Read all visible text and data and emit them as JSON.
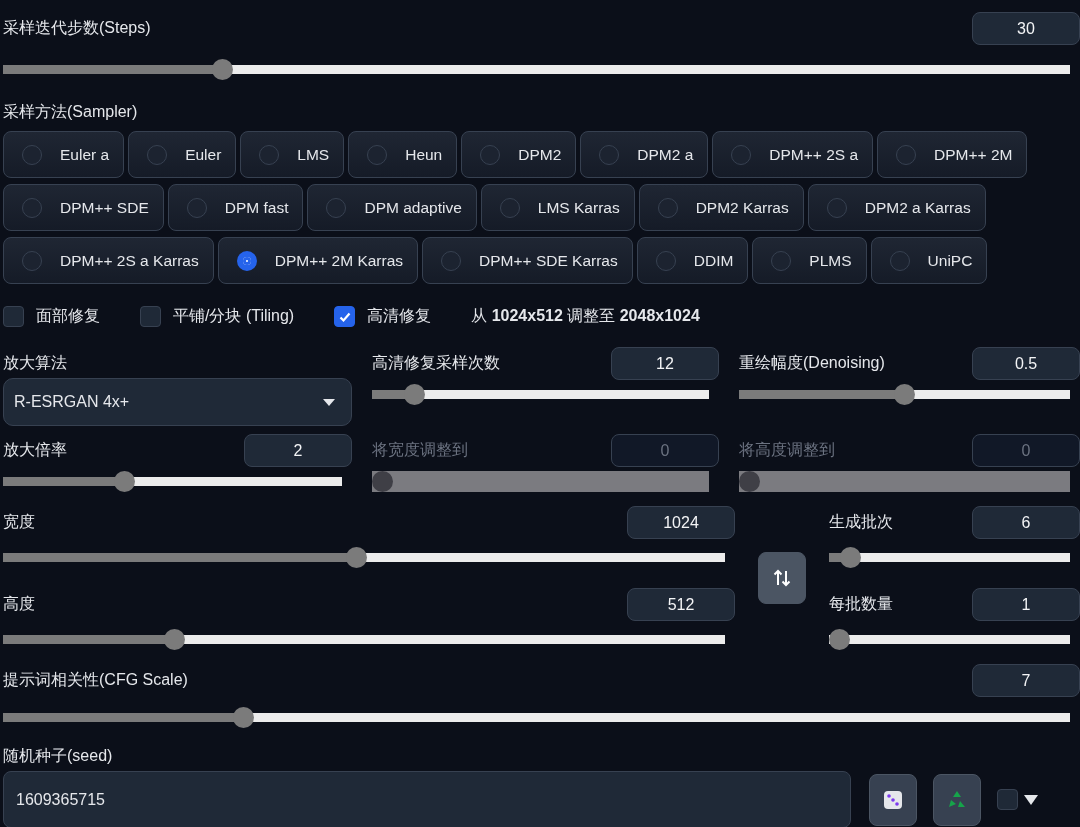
{
  "steps": {
    "label": "采样迭代步数(Steps)",
    "value": "30",
    "level": 0.2,
    "disabled": false
  },
  "sampler": {
    "label": "采样方法(Sampler)",
    "items": [
      {
        "label": "Euler a",
        "selected": false
      },
      {
        "label": "Euler",
        "selected": false
      },
      {
        "label": "LMS",
        "selected": false
      },
      {
        "label": "Heun",
        "selected": false
      },
      {
        "label": "DPM2",
        "selected": false
      },
      {
        "label": "DPM2 a",
        "selected": false
      },
      {
        "label": "DPM++ 2S a",
        "selected": false
      },
      {
        "label": "DPM++ 2M",
        "selected": false
      },
      {
        "label": "DPM++ SDE",
        "selected": false
      },
      {
        "label": "DPM fast",
        "selected": false
      },
      {
        "label": "DPM adaptive",
        "selected": false
      },
      {
        "label": "LMS Karras",
        "selected": false
      },
      {
        "label": "DPM2 Karras",
        "selected": false
      },
      {
        "label": "DPM2 a Karras",
        "selected": false
      },
      {
        "label": "DPM++ 2S a Karras",
        "selected": false
      },
      {
        "label": "DPM++ 2M Karras",
        "selected": true
      },
      {
        "label": "DPM++ SDE Karras",
        "selected": false
      },
      {
        "label": "DDIM",
        "selected": false
      },
      {
        "label": "PLMS",
        "selected": false
      },
      {
        "label": "UniPC",
        "selected": false
      }
    ]
  },
  "options": [
    {
      "label": "面部修复",
      "checked": false
    },
    {
      "label": "平铺/分块 (Tiling)",
      "checked": false
    },
    {
      "label": "高清修复",
      "checked": true
    }
  ],
  "hires_note": "从 **1024x512** 调整至 **2048x1024**",
  "upscaler": {
    "label": "放大算法",
    "value": "R-ESRGAN 4x+"
  },
  "hires_sliders": [
    {
      "label": "高清修复采样次数",
      "value": "12",
      "level": 0.1,
      "disabled": false
    },
    {
      "label": "重绘幅度(Denoising)",
      "value": "0.5",
      "level": 0.5,
      "disabled": false
    },
    {
      "label": "放大倍率",
      "value": "2",
      "level": 0.35,
      "disabled": false
    },
    {
      "label": "将宽度调整到",
      "value": "0",
      "level": 0,
      "disabled": true
    },
    {
      "label": "将高度调整到",
      "value": "0",
      "level": 0,
      "disabled": true
    }
  ],
  "size": [
    {
      "label": "宽度",
      "value": "1024",
      "level": 0.49,
      "disabled": false
    },
    {
      "label": "高度",
      "value": "512",
      "level": 0.23,
      "disabled": false
    }
  ],
  "batch": [
    {
      "label": "生成批次",
      "value": "6",
      "level": 0.05,
      "disabled": false
    },
    {
      "label": "每批数量",
      "value": "1",
      "level": 0,
      "disabled": false
    }
  ],
  "cfg": {
    "label": "提示词相关性(CFG Scale)",
    "value": "7",
    "level": 0.22,
    "disabled": false
  },
  "seed": {
    "label": "随机种子(seed)",
    "value": "1609365715",
    "extra_checked": false
  }
}
